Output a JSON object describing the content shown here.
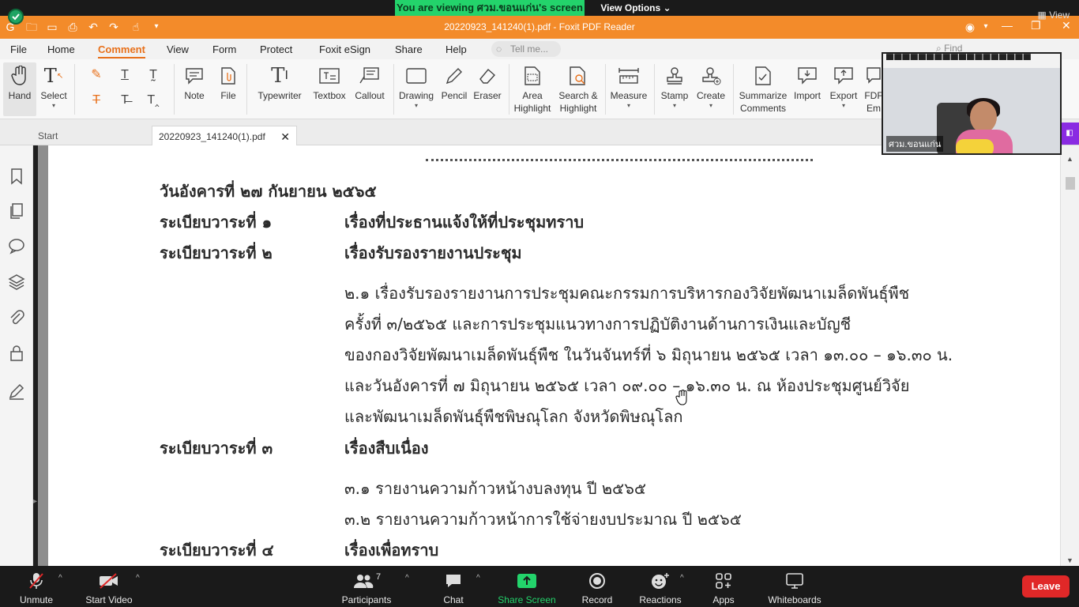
{
  "zoom": {
    "viewing_banner": "You are viewing ศวม.ขอนแก่น's screen",
    "view_options": "View Options",
    "view_label": "View",
    "participant_count": "7",
    "toolbar": [
      {
        "key": "unmute",
        "label": "Unmute"
      },
      {
        "key": "video",
        "label": "Start Video"
      },
      {
        "key": "participants",
        "label": "Participants"
      },
      {
        "key": "chat",
        "label": "Chat"
      },
      {
        "key": "share",
        "label": "Share Screen"
      },
      {
        "key": "record",
        "label": "Record"
      },
      {
        "key": "reactions",
        "label": "Reactions"
      },
      {
        "key": "apps",
        "label": "Apps"
      },
      {
        "key": "whiteboards",
        "label": "Whiteboards"
      }
    ],
    "leave": "Leave",
    "video_name": "ศวม.ขอนแก่น"
  },
  "app": {
    "title": "20220923_141240(1).pdf - Foxit PDF Reader",
    "menu": [
      "File",
      "Home",
      "Comment",
      "View",
      "Form",
      "Protect",
      "Foxit eSign",
      "Share",
      "Help"
    ],
    "active_menu": "Comment",
    "tell_me": "Tell me...",
    "find": "Find"
  },
  "ribbon": {
    "hand": "Hand",
    "select": "Select",
    "note": "Note",
    "file": "File",
    "typewriter": "Typewriter",
    "textbox": "Textbox",
    "callout": "Callout",
    "drawing": "Drawing",
    "pencil": "Pencil",
    "eraser": "Eraser",
    "area_highlight_1": "Area",
    "area_highlight_2": "Highlight",
    "search_highlight_1": "Search &",
    "search_highlight_2": "Highlight",
    "measure": "Measure",
    "stamp": "Stamp",
    "create": "Create",
    "summarize_1": "Summarize",
    "summarize_2": "Comments",
    "import": "Import",
    "export": "Export",
    "fdf_1": "FDF",
    "fdf_2": "Em"
  },
  "tabs": {
    "start": "Start",
    "doc": "20220923_141240(1).pdf"
  },
  "document": {
    "date_line": "วันอังคารที่ ๒๗ กันยายน ๒๕๖๕",
    "agenda": [
      {
        "label": "ระเบียบวาระที่ ๑",
        "title": "เรื่องที่ประธานแจ้งให้ที่ประชุมทราบ"
      },
      {
        "label": "ระเบียบวาระที่ ๒",
        "title": "เรื่องรับรองรายงานประชุม"
      },
      {
        "label": "ระเบียบวาระที่ ๓",
        "title": "เรื่องสืบเนื่อง"
      },
      {
        "label": "ระเบียบวาระที่ ๔",
        "title": "เรื่องเพื่อทราบ"
      }
    ],
    "item_2_1": [
      "๒.๑ เรื่องรับรองรายงานการประชุมคณะกรรมการบริหารกองวิจัยพัฒนาเมล็ดพันธุ์พืช",
      "ครั้งที่ ๓/๒๕๖๕ และการประชุมแนวทางการปฏิบัติงานด้านการเงินและบัญชี",
      "ของกองวิจัยพัฒนาเมล็ดพันธุ์พืช ในวันจันทร์ที่ ๖ มิถุนายน ๒๕๖๕ เวลา ๑๓.๐๐ – ๑๖.๓๐ น.",
      "และวันอังคารที่ ๗ มิถุนายน ๒๕๖๕ เวลา ๐๙.๐๐  – ๑๖.๓๐ น. ณ ห้องประชุมศูนย์วิจัย",
      "และพัฒนาเมล็ดพันธุ์พืชพิษณุโลก จังหวัดพิษณุโลก"
    ],
    "item_3": [
      "๓.๑ รายงานความก้าวหน้างบลงทุน ปี ๒๕๖๕",
      "๓.๒ รายงานความก้าวหน้าการใช้จ่ายงบประมาณ ปี ๒๕๖๕"
    ]
  },
  "colors": {
    "foxit_orange": "#f38b2a",
    "zoom_green": "#23d36b",
    "leave_red": "#e02828"
  }
}
